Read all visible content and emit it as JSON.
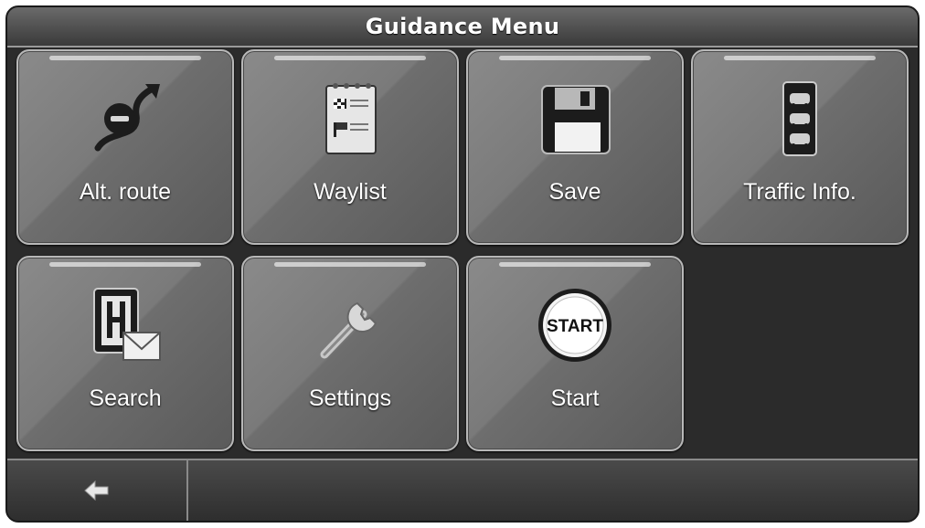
{
  "header": {
    "title": "Guidance Menu"
  },
  "menu": {
    "items": [
      {
        "label": "Alt. route",
        "icon": "alt-route-icon"
      },
      {
        "label": "Waylist",
        "icon": "waylist-icon"
      },
      {
        "label": "Save",
        "icon": "floppy-disk-icon"
      },
      {
        "label": "Traffic Info.",
        "icon": "traffic-info-icon"
      },
      {
        "label": "Search",
        "icon": "hotel-search-icon"
      },
      {
        "label": "Settings",
        "icon": "wrench-icon"
      },
      {
        "label": "Start",
        "icon": "start-icon",
        "badge_text": "START"
      }
    ]
  },
  "footer": {
    "back_icon": "back-arrow-icon"
  }
}
